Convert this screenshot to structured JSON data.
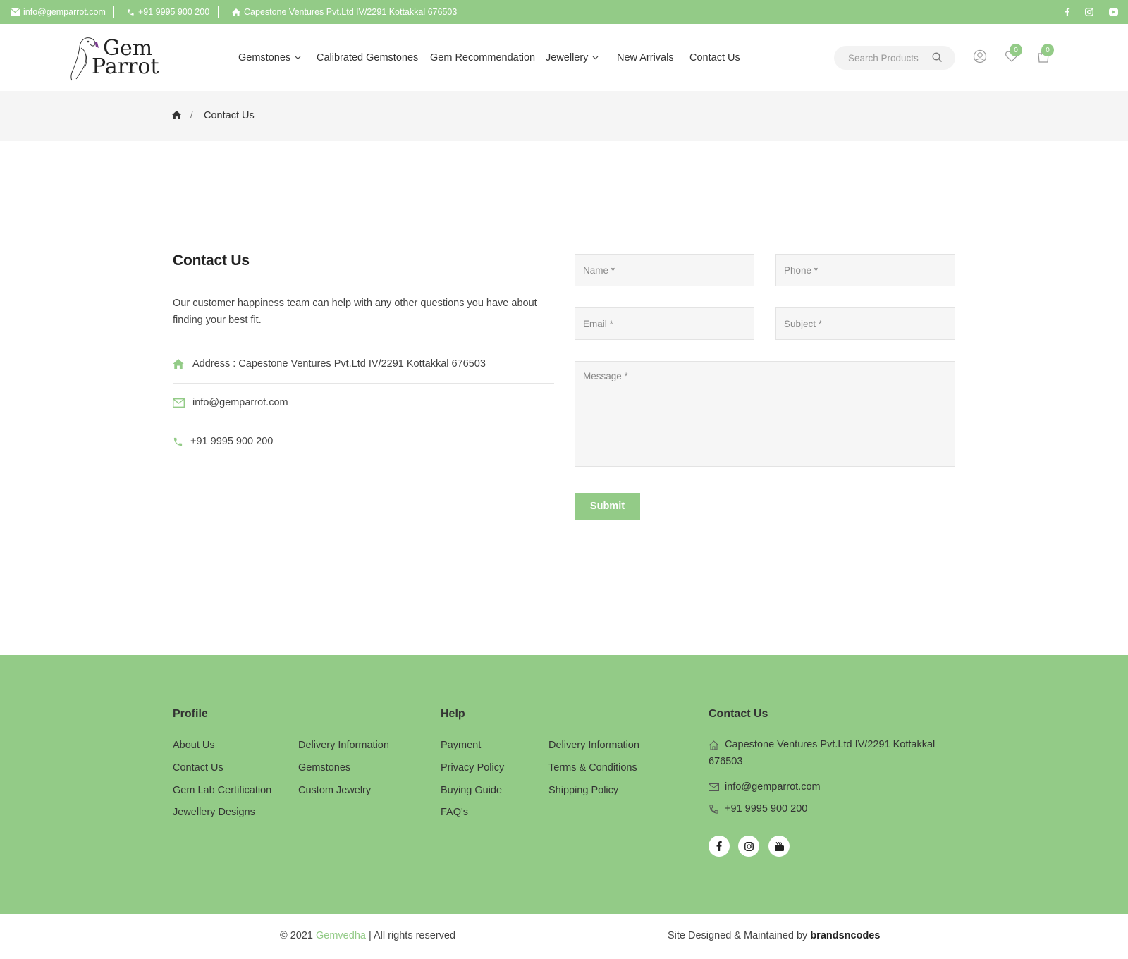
{
  "topbar": {
    "email": "info@gemparrot.com",
    "phone": "+91 9995 900 200",
    "address": "Capestone Ventures Pvt.Ltd IV/2291 Kottakkal 676503",
    "social": [
      "facebook-icon",
      "instagram-icon",
      "youtube-icon"
    ]
  },
  "header": {
    "logo_line1": "Gem",
    "logo_line2": "Parrot",
    "nav": [
      {
        "label": "Gemstones",
        "dropdown": true
      },
      {
        "label": "Calibrated Gemstones",
        "dropdown": false
      },
      {
        "label": "Gem Recommendation",
        "dropdown": false
      },
      {
        "label": "Jewellery",
        "dropdown": true
      },
      {
        "label": "New Arrivals",
        "dropdown": false
      },
      {
        "label": "Contact Us",
        "dropdown": false
      }
    ],
    "search_placeholder": "Search Products",
    "wishlist_count": "0",
    "cart_count": "0"
  },
  "breadcrumb": {
    "current": "Contact Us"
  },
  "contact": {
    "title": "Contact Us",
    "description": "Our customer happiness team can help with any other questions you have about finding your best fit.",
    "address": "Address : Capestone Ventures Pvt.Ltd IV/2291 Kottakkal 676503",
    "email": "info@gemparrot.com",
    "phone": "+91 9995 900 200"
  },
  "form": {
    "name_placeholder": "Name *",
    "phone_placeholder": "Phone *",
    "email_placeholder": "Email *",
    "subject_placeholder": "Subject *",
    "message_placeholder": "Message *",
    "submit_label": "Submit"
  },
  "footer": {
    "profile_title": "Profile",
    "profile_links_col1": [
      "About Us",
      "Contact Us",
      "Gem Lab Certification",
      "Jewellery Designs"
    ],
    "profile_links_col2": [
      "Delivery Information",
      "Gemstones",
      "Custom Jewelry"
    ],
    "help_title": "Help",
    "help_links_col1": [
      "Payment",
      "Privacy Policy",
      "Buying Guide",
      "FAQ's"
    ],
    "help_links_col2": [
      "Delivery Information",
      "Terms & Conditions",
      "Shipping Policy"
    ],
    "contact_title": "Contact Us",
    "contact_address": "Capestone Ventures Pvt.Ltd IV/2291 Kottakkal 676503",
    "contact_email": "info@gemparrot.com",
    "contact_phone": "+91 9995 900 200"
  },
  "copyright": {
    "prefix": "© 2021",
    "brand": "Gemvedha",
    "suffix": "| All rights reserved",
    "designed_by_label": "Site Designed & Maintained by",
    "designer": "brandsncodes"
  },
  "colors": {
    "accent": "#93cb87",
    "breadcrumb_bg": "#f5f5f5"
  }
}
